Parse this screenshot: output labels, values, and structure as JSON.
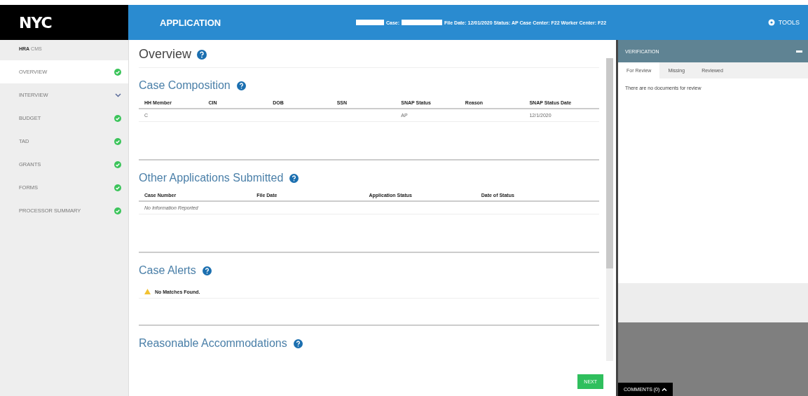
{
  "header": {
    "logo": "NYC",
    "title": "APPLICATION",
    "case_label": "Case:",
    "case_info": "File Date: 12/01/2020 Status: AP Case Center: F22 Worker Center: F22",
    "tools": "TOOLS"
  },
  "sidebar": {
    "brand_bold": "HRA",
    "brand": "CMS",
    "items": [
      {
        "label": "OVERVIEW",
        "selected": true,
        "kind": "check"
      },
      {
        "label": "INTERVIEW",
        "selected": false,
        "kind": "chevron"
      },
      {
        "label": "BUDGET",
        "selected": false,
        "kind": "check"
      },
      {
        "label": "TAD",
        "selected": false,
        "kind": "check"
      },
      {
        "label": "GRANTS",
        "selected": false,
        "kind": "check"
      },
      {
        "label": "FORMS",
        "selected": false,
        "kind": "check"
      },
      {
        "label": "PROCESSOR SUMMARY",
        "selected": false,
        "kind": "check"
      }
    ]
  },
  "main": {
    "title": "Overview",
    "sections": [
      {
        "title": "Case Composition",
        "kind": "table",
        "columns": [
          "HH Member",
          "CIN",
          "DOB",
          "SSN",
          "SNAP Status",
          "Reason",
          "SNAP Status Date"
        ],
        "rows": [
          [
            "C",
            "",
            "",
            "",
            "AP",
            "",
            "12/1/2020"
          ]
        ]
      },
      {
        "title": "Other Applications Submitted",
        "kind": "table",
        "columns": [
          "Case Number",
          "File Date",
          "Application Status",
          "Date of Status"
        ],
        "empty": "No Information Reported"
      },
      {
        "title": "Case Alerts",
        "kind": "alert",
        "message": "No Matches Found."
      },
      {
        "title": "Reasonable Accommodations",
        "kind": "plain"
      }
    ],
    "next": "NEXT"
  },
  "verification": {
    "title": "VERIFICATION",
    "tabs": [
      {
        "label": "For Review",
        "selected": true
      },
      {
        "label": "Missing",
        "selected": false
      },
      {
        "label": "Reviewed",
        "selected": false
      }
    ],
    "message": "There are no documents for review"
  },
  "comments": "COMMENTS (0)"
}
